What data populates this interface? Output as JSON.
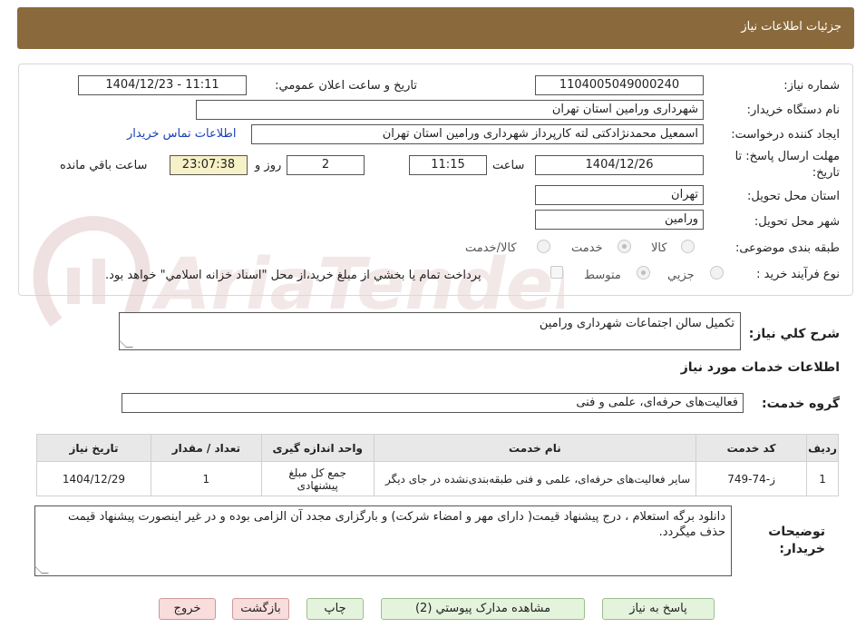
{
  "header": {
    "title": "جزئیات اطلاعات نیاز"
  },
  "form": {
    "need_number": {
      "label": "شماره نیاز:",
      "value": "1104005049000240"
    },
    "announce_datetime": {
      "label": "تاریخ و ساعت اعلان عمومي:",
      "value": "1404/12/23 - 11:11"
    },
    "buyer_org": {
      "label": "نام دستگاه خريدار:",
      "value": "شهرداری ورامين استان تهران"
    },
    "requester": {
      "label": "ايجاد کننده درخواست:",
      "value": "اسمعیل محمدنژادکتی لته کارپرداز شهرداری ورامين استان تهران",
      "contact_link": "اطلاعات تماس خريدار"
    },
    "deadline": {
      "label_line1": "مهلت ارسال پاسخ: تا",
      "label_line2": "تاريخ:",
      "date": "1404/12/26",
      "time_label": "ساعت",
      "time": "11:15",
      "days": "2",
      "days_label": "روز و",
      "remaining": "23:07:38",
      "remaining_label": "ساعت باقي مانده"
    },
    "province": {
      "label": "استان محل تحويل:",
      "value": "تهران"
    },
    "city": {
      "label": "شهر محل تحويل:",
      "value": "ورامين"
    },
    "category": {
      "label": "طبقه بندی موضوعی:",
      "options": [
        "کالا",
        "خدمت",
        "کالا/خدمت"
      ],
      "selected": "خدمت"
    },
    "purchase_type": {
      "label": "نوع فرآيند خريد :",
      "options": [
        "جزيي",
        "متوسط"
      ],
      "selected": "متوسط",
      "payment_note": "پرداخت تمام يا بخشي از مبلغ خريد،از محل \"اسناد خزانه اسلامي\" خواهد بود."
    }
  },
  "summary": {
    "label": "شرح کلي نياز:",
    "value": "تکمیل سالن اجتماعات شهرداری ورامين"
  },
  "services": {
    "section_title": "اطلاعات خدمات مورد نياز",
    "group_label": "گروه خدمت:",
    "group_value": "فعاليت‌هاى حرفه‌اى، علمى و فنى",
    "columns": [
      "رديف",
      "کد خدمت",
      "نام خدمت",
      "واحد اندازه گيری",
      "تعداد / مقدار",
      "تاريخ نياز"
    ],
    "rows": [
      {
        "row": "1",
        "code": "ز-74-749",
        "name": "ساير فعاليت‌هاى حرفه‌اى، علمى و فنى طبقه‌بندى‌نشده در جای ديگر",
        "unit": "جمع کل مبلغ پيشنهادی",
        "qty": "1",
        "date": "1404/12/29"
      }
    ]
  },
  "buyer_notes": {
    "label_line1": "توضيحات",
    "label_line2": "خريدار:",
    "value": "دانلود برگه استعلام ، درج پيشنهاد قيمت( دارای مهر و امضاء شرکت) و بارگزاری مجدد آن الزامی بوده و در غير اينصورت پيشنهاد قيمت حذف ميگردد."
  },
  "buttons": {
    "respond": "پاسخ به نياز",
    "attachments": "مشاهده مدارک پيوستي (2)",
    "print": "چاپ",
    "back": "بازگشت",
    "exit": "خروج"
  },
  "watermark": {
    "text": "AriaTender.neT"
  },
  "colors": {
    "header_bg": "#8a6a3c",
    "link": "#1a3fb8",
    "button_green": "#e4f3dc",
    "button_red": "#f9dcdc",
    "highlight_yellow": "#f6f1c6"
  },
  "icons": [
    "resize-grip-icon",
    "aria-tender-logo-icon"
  ]
}
